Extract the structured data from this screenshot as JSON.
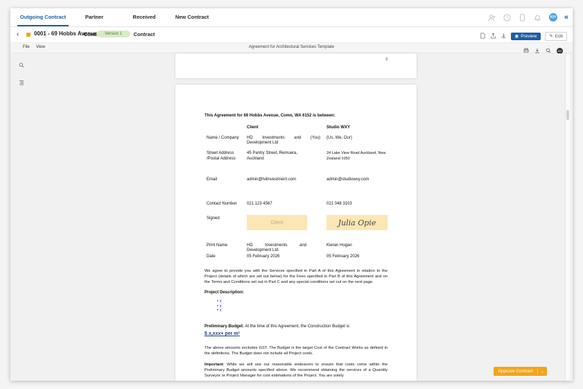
{
  "tabs": [
    {
      "label": "Outgoing Contract",
      "active": true
    },
    {
      "label": "Partner Contract",
      "active": false
    },
    {
      "label": "Received Contract",
      "active": false
    },
    {
      "label": "New Contract",
      "active": false
    }
  ],
  "header": {
    "avatar_initials": "KH",
    "icons": [
      "add-user-icon",
      "help-icon",
      "mobile-icon",
      "bell-icon",
      "avatar",
      "collapse-icon"
    ]
  },
  "document": {
    "title": "0001 - 69 Hobbs Avenue",
    "version": "Version 1",
    "status_color": "#f2a51a",
    "preview_label": "Preview",
    "edit_label": "Edit"
  },
  "menu": {
    "file": "File",
    "view": "View",
    "doc_name": "Agreement for Architectural Services Template",
    "avatar_initials": "KH"
  },
  "page1": {
    "page_number": "3"
  },
  "agreement": {
    "heading": "This Agreement for 69 Hobbs Avenue, Como, WA 6152 is between:",
    "client_header": "Client",
    "studio_header": "Studio WXY",
    "rows": [
      {
        "label": "Name / Company",
        "client": "HD Investments and (You) Development Ltd",
        "studio": "(Us, We, Our)"
      },
      {
        "label": "Street Address /Postal Address",
        "client": "45 Pantry Street, Remuera, Auckland",
        "studio": "24 Lake View Road Auckland, New Zealand 1050"
      },
      {
        "label": "Email",
        "client": "admin@hdinvestment.com",
        "studio": "admin@studiowxy.com"
      },
      {
        "label": "Contact Number",
        "client": "021 123 4567",
        "studio": "021 048 3103"
      },
      {
        "label": "Signed",
        "client": "Client",
        "studio": "Julia Opie"
      },
      {
        "label": "Print Name",
        "client": "HD Investments and Development Ltd",
        "studio": "Kieran Hogan"
      },
      {
        "label": "Date",
        "client": "05 February 2026",
        "studio": "05 February 2026"
      }
    ],
    "services_para": "We agree to provide you with the Services specified in Part A of this Agreement in relation to the Project (details of which are set out below) for the Fees specified in Part B of this Agreement and on the Terms and Conditions set out in Part C and any special conditions set out on the next page.",
    "project_desc_label": "Project Description:",
    "project_bullets": [
      "x",
      "x",
      "x"
    ],
    "prelim_label": "Preliminary Budget:",
    "prelim_text": " At the time of this Agreement, the Construction Budget is",
    "budget_value": "$ x,xxx+ per m²",
    "gst_para": "The above amounts excludes GST. The Budget is the target Cost of the Contract Works as defined in the definitions. The Budget does not include all Project costs.",
    "important_label": "Important:",
    "important_text": " While we will use our reasonable endeavors to ensure that costs come within the Preliminary Budget amounts specified above. We recommend obtaining the services of a Quantity Surveyor or Project Manager for cost estimations of the Project. You are solely"
  },
  "approve": {
    "label": "Approve Contract",
    "color": "#f2a51a"
  }
}
